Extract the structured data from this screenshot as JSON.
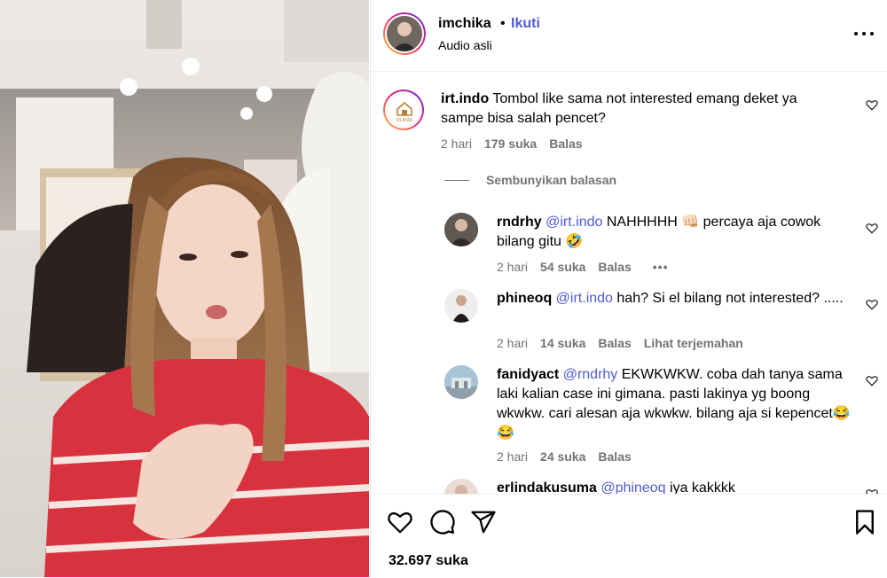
{
  "header": {
    "username": "imchika",
    "separator": "•",
    "follow_label": "Ikuti",
    "subtitle": "Audio asli"
  },
  "comments": [
    {
      "user": "irt.indo",
      "text": "Tombol like sama not interested emang deket ya sampe bisa salah pencet?",
      "time": "2 hari",
      "likes": "179 suka",
      "reply": "Balas",
      "avatar_text": "irt.indo"
    },
    {
      "user": "rndrhy",
      "mention": "@irt.indo",
      "text": "NAHHHHH 👊🏻 percaya aja cowok bilang gitu 🤣",
      "time": "2 hari",
      "likes": "54 suka",
      "reply": "Balas",
      "more": "•••"
    },
    {
      "user": "phineoq",
      "mention": "@irt.indo",
      "text": "hah? Si el bilang not interested? .....",
      "time": "2 hari",
      "likes": "14 suka",
      "reply": "Balas",
      "translate": "Lihat terjemahan"
    },
    {
      "user": "fanidyact",
      "mention": "@rndrhy",
      "text": "EKWKWKW. coba dah tanya sama laki kalian case ini gimana. pasti lakinya yg boong wkwkw. cari alesan aja wkwkw. bilang aja si kepencet😂😂",
      "time": "2 hari",
      "likes": "24 suka",
      "reply": "Balas"
    },
    {
      "user": "erlindakusuma",
      "mention": "@phineoq",
      "text": "iya kakkkk"
    }
  ],
  "hide_replies": "Sembunyikan balasan",
  "footer": {
    "likes_count": "32.697 suka"
  },
  "icons": {
    "like": "heart-icon",
    "comment": "comment-icon",
    "share": "share-icon",
    "save": "bookmark-icon",
    "more": "more-options-icon"
  },
  "colors": {
    "mention": "#4f5bd5",
    "meta": "#737373"
  }
}
